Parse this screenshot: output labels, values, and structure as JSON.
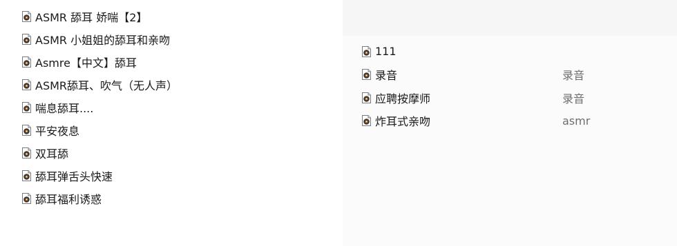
{
  "left_files": [
    {
      "name": "ASMR 舔耳 娇喘【2】",
      "icon": "audio-file-icon"
    },
    {
      "name": "ASMR 小姐姐的舔耳和亲吻",
      "icon": "audio-file-icon"
    },
    {
      "name": "Asmre【中文】舔耳",
      "icon": "audio-file-icon"
    },
    {
      "name": "ASMR舔耳、吹气（无人声）",
      "icon": "audio-file-icon"
    },
    {
      "name": "喘息舔耳....",
      "icon": "audio-file-icon"
    },
    {
      "name": "平安夜息",
      "icon": "audio-file-icon"
    },
    {
      "name": "双耳舔",
      "icon": "audio-file-icon"
    },
    {
      "name": "舔耳弹舌头快速",
      "icon": "audio-file-icon"
    },
    {
      "name": "舔耳福利诱惑",
      "icon": "audio-file-icon"
    }
  ],
  "right_files": [
    {
      "name": "111",
      "note": "",
      "icon": "audio-file-icon"
    },
    {
      "name": "录音",
      "note": "录音",
      "icon": "audio-file-icon"
    },
    {
      "name": "应聘按摩师",
      "note": "录音",
      "icon": "audio-file-icon"
    },
    {
      "name": "炸耳式亲吻",
      "note": "asmr",
      "icon": "audio-file-icon"
    }
  ],
  "colors": {
    "icon_frame": "#7a7a7a",
    "icon_disc": "#3a3a3a",
    "icon_center": "#e08a2c"
  }
}
